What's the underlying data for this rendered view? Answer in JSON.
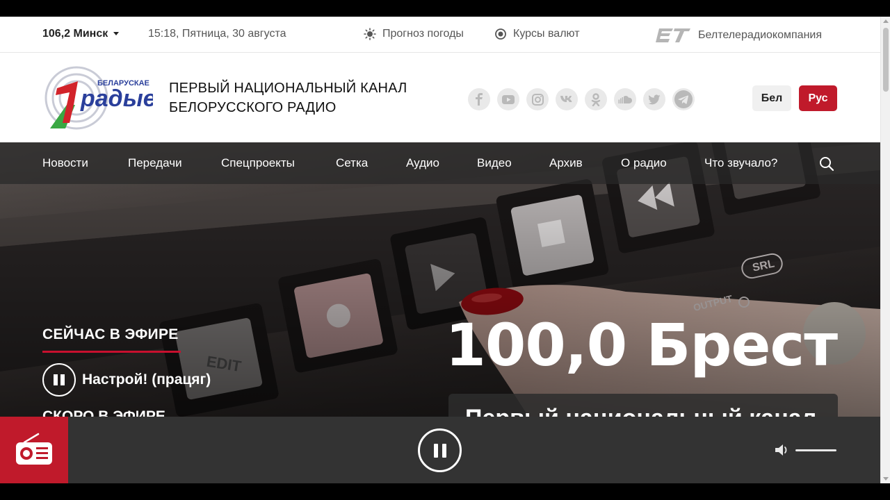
{
  "topbar": {
    "city": "106,2 Минск",
    "datetime": "15:18, Пятница, 30 августа",
    "weather": "Прогноз погоды",
    "currency": "Курсы валют",
    "belteleradio": "Белтелерадиокомпания"
  },
  "header": {
    "logo_text": "БЕЛАРУСКАЕ",
    "logo_word": "радые",
    "title_line1": "ПЕРВЫЙ НАЦИОНАЛЬНЫЙ КАНАЛ",
    "title_line2": "БЕЛОРУССКОГО РАДИО",
    "social": [
      "facebook-icon",
      "youtube-icon",
      "instagram-icon",
      "vk-icon",
      "odnoklassniki-icon",
      "soundcloud-icon",
      "twitter-icon",
      "telegram-icon"
    ],
    "lang_bel": "Бел",
    "lang_rus": "Рус"
  },
  "nav": {
    "items": [
      "Новости",
      "Передачи",
      "Спецпроекты",
      "Сетка",
      "Аудио",
      "Видео",
      "Архив",
      "О радио",
      "Что звучало?"
    ]
  },
  "hero": {
    "on_air_label": "СЕЙЧАС В ЭФИРЕ",
    "program": "Настрой! (працяг)",
    "soon_label": "СКОРО В ЭФИРЕ",
    "frequency": "100,0 Брест",
    "channel": "Первый национальный канал"
  },
  "colors": {
    "accent": "#c01a2b",
    "player_bg": "#333333"
  }
}
